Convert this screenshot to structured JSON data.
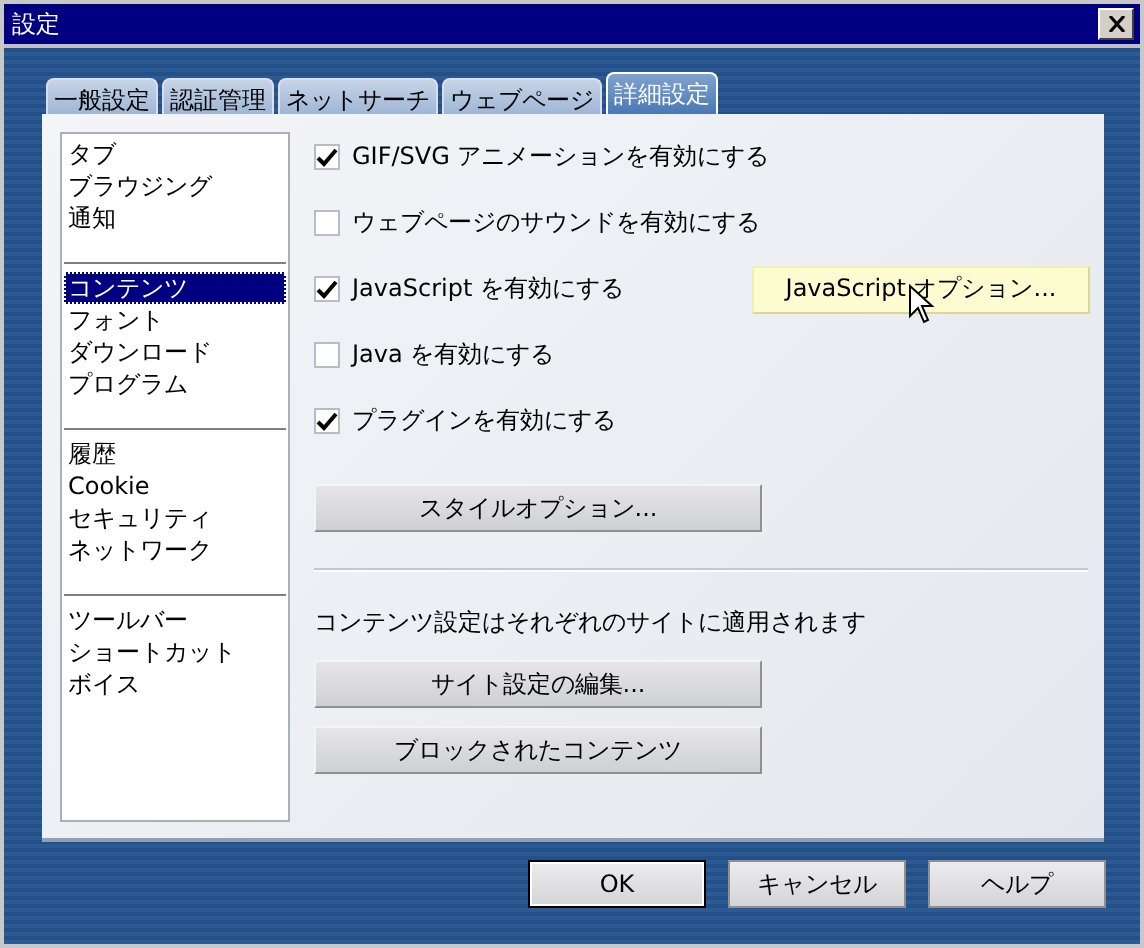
{
  "window": {
    "title": "設定"
  },
  "tabs": [
    {
      "label": "一般設定",
      "selected": false
    },
    {
      "label": "認証管理",
      "selected": false
    },
    {
      "label": "ネットサーチ",
      "selected": false
    },
    {
      "label": "ウェブページ",
      "selected": false
    },
    {
      "label": "詳細設定",
      "selected": true
    }
  ],
  "sidebar": {
    "groups": [
      {
        "items": [
          {
            "label": "タブ",
            "selected": false
          },
          {
            "label": "ブラウジング",
            "selected": false
          },
          {
            "label": "通知",
            "selected": false
          }
        ]
      },
      {
        "items": [
          {
            "label": "コンテンツ",
            "selected": true
          },
          {
            "label": "フォント",
            "selected": false
          },
          {
            "label": "ダウンロード",
            "selected": false
          },
          {
            "label": "プログラム",
            "selected": false
          }
        ]
      },
      {
        "items": [
          {
            "label": "履歴",
            "selected": false
          },
          {
            "label": "Cookie",
            "selected": false
          },
          {
            "label": "セキュリティ",
            "selected": false
          },
          {
            "label": "ネットワーク",
            "selected": false
          }
        ]
      },
      {
        "items": [
          {
            "label": "ツールバー",
            "selected": false
          },
          {
            "label": "ショートカット",
            "selected": false
          },
          {
            "label": "ボイス",
            "selected": false
          }
        ]
      }
    ]
  },
  "options": [
    {
      "label": "GIF/SVG アニメーションを有効にする",
      "checked": true
    },
    {
      "label": "ウェブページのサウンドを有効にする",
      "checked": false
    },
    {
      "label": "JavaScript を有効にする",
      "checked": true,
      "button": {
        "label": "JavaScript オプション...",
        "hovered": true
      }
    },
    {
      "label": "Java を有効にする",
      "checked": false
    },
    {
      "label": "プラグインを有効にする",
      "checked": true
    }
  ],
  "style_button": {
    "label": "スタイルオプション...",
    "hovered": false
  },
  "note": "コンテンツ設定はそれぞれのサイトに適用されます",
  "content_buttons": [
    {
      "label": "サイト設定の編集...",
      "hovered": false
    },
    {
      "label": "ブロックされたコンテンツ",
      "hovered": false
    }
  ],
  "dialog_buttons": [
    {
      "label": "OK",
      "default": true
    },
    {
      "label": "キャンセル",
      "default": false
    },
    {
      "label": "ヘルプ",
      "default": false
    }
  ]
}
